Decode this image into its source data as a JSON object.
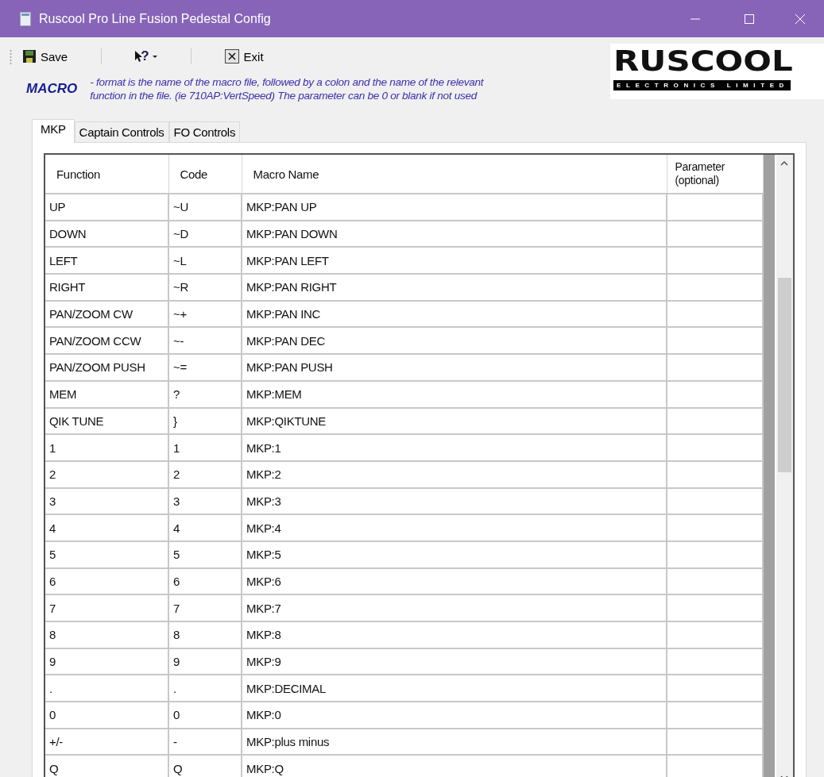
{
  "window": {
    "title": "Ruscool Pro Line Fusion Pedestal Config"
  },
  "toolbar": {
    "save": "Save",
    "help_glyph": "?",
    "exit": "Exit"
  },
  "logo": {
    "name": "RUSCOOL",
    "tagline": "ELECTRONICS LIMITED"
  },
  "macro": {
    "label": "MACRO",
    "note_lines": [
      "- format is the name of the macro file, followed by a colon and the name of the relevant",
      "function in the file.  (ie 710AP:VertSpeed)  The parameter can be 0 or blank if not used"
    ]
  },
  "tabs": [
    {
      "label": "MKP",
      "selected": true
    },
    {
      "label": "Captain Controls",
      "selected": false
    },
    {
      "label": "FO Controls",
      "selected": false
    }
  ],
  "table": {
    "columns": [
      "Function",
      "Code",
      "Macro Name",
      "Parameter (optional)"
    ],
    "rows": [
      {
        "function": "UP",
        "code": "~U",
        "macro": "MKP:PAN UP"
      },
      {
        "function": "DOWN",
        "code": "~D",
        "macro": "MKP:PAN DOWN"
      },
      {
        "function": "LEFT",
        "code": "~L",
        "macro": "MKP:PAN LEFT"
      },
      {
        "function": "RIGHT",
        "code": "~R",
        "macro": "MKP:PAN RIGHT"
      },
      {
        "function": "PAN/ZOOM CW",
        "code": "~+",
        "macro": "MKP:PAN INC"
      },
      {
        "function": "PAN/ZOOM CCW",
        "code": "~-",
        "macro": "MKP:PAN DEC"
      },
      {
        "function": "PAN/ZOOM PUSH",
        "code": "~=",
        "macro": "MKP:PAN PUSH"
      },
      {
        "function": "MEM",
        "code": "?",
        "macro": "MKP:MEM"
      },
      {
        "function": "QIK TUNE",
        "code": "}",
        "macro": "MKP:QIKTUNE"
      },
      {
        "function": "1",
        "code": "1",
        "macro": "MKP:1"
      },
      {
        "function": "2",
        "code": "2",
        "macro": "MKP:2"
      },
      {
        "function": "3",
        "code": "3",
        "macro": "MKP:3"
      },
      {
        "function": "4",
        "code": "4",
        "macro": "MKP:4"
      },
      {
        "function": "5",
        "code": "5",
        "macro": "MKP:5"
      },
      {
        "function": "6",
        "code": "6",
        "macro": "MKP:6"
      },
      {
        "function": "7",
        "code": "7",
        "macro": "MKP:7"
      },
      {
        "function": "8",
        "code": "8",
        "macro": "MKP:8"
      },
      {
        "function": "9",
        "code": "9",
        "macro": "MKP:9"
      },
      {
        "function": ".",
        "code": ".",
        "macro": "MKP:DECIMAL"
      },
      {
        "function": "0",
        "code": "0",
        "macro": "MKP:0"
      },
      {
        "function": "+/-",
        "code": "-",
        "macro": "MKP:plus minus"
      },
      {
        "function": "Q",
        "code": "Q",
        "macro": "MKP:Q"
      }
    ]
  }
}
